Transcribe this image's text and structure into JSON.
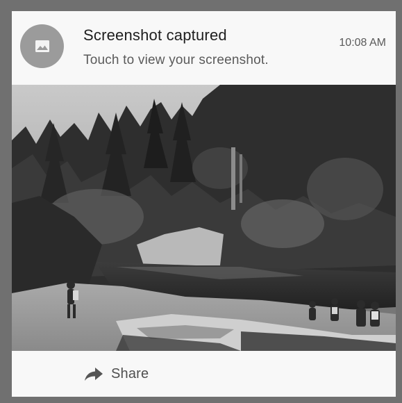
{
  "notification": {
    "title": "Screenshot captured",
    "subtitle": "Touch to view your screenshot.",
    "time": "10:08 AM",
    "icon": "image-icon"
  },
  "preview": {
    "description_icon": "screenshot-preview"
  },
  "actions": [
    {
      "label": "Share",
      "icon": "share-arrow-icon"
    }
  ],
  "colors": {
    "frame": "#707070",
    "card": "#f7f7f7",
    "icon_circle": "#9b9b9b"
  }
}
